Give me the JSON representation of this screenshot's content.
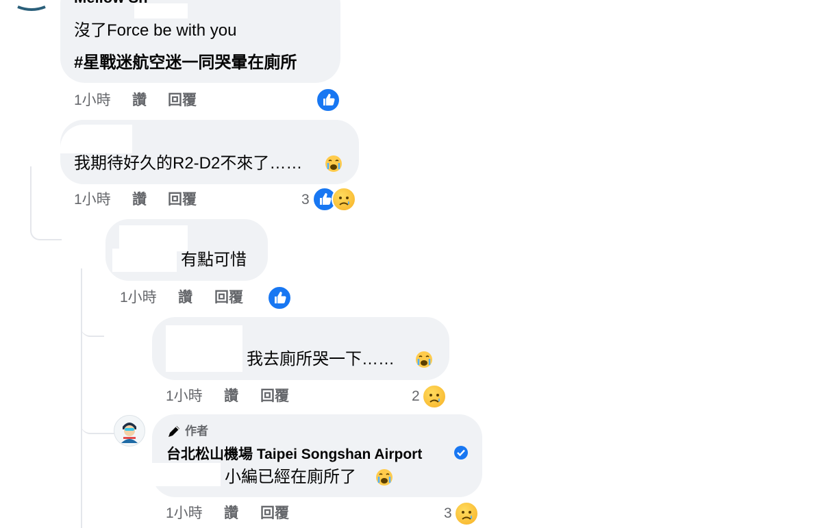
{
  "comments": [
    {
      "author": "Mellow Sh",
      "text_line1": "沒了Force be with you",
      "text_line2": "#星戰迷航空迷一同哭暈在廁所",
      "time": "1小時",
      "like_action": "讚",
      "reply_action": "回覆",
      "reactions": [
        "like-icon"
      ]
    },
    {
      "text": "我期待好久的R2-D2不來了……",
      "time": "1小時",
      "like_action": "讚",
      "reply_action": "回覆",
      "reaction_count": "3",
      "reactions": [
        "like-icon",
        "sad-icon"
      ]
    },
    {
      "text": "有點可惜",
      "time": "1小時",
      "like_action": "讚",
      "reply_action": "回覆",
      "reactions": [
        "like-icon"
      ]
    },
    {
      "text": "我去廁所哭一下……",
      "time": "1小時",
      "like_action": "讚",
      "reply_action": "回覆",
      "reaction_count": "2",
      "reactions": [
        "sad-icon"
      ]
    },
    {
      "author_badge": "作者",
      "author": "台北松山機場 Taipei Songshan Airport",
      "verified": true,
      "text": "小編已經在廁所了",
      "time": "1小時",
      "like_action": "讚",
      "reply_action": "回覆",
      "reaction_count": "3",
      "reactions": [
        "sad-icon"
      ]
    }
  ],
  "colors": {
    "bubble": "#f0f2f5",
    "meta_text": "#65676b",
    "like_blue": "#1877f2",
    "thread_line": "#e4e6eb"
  }
}
